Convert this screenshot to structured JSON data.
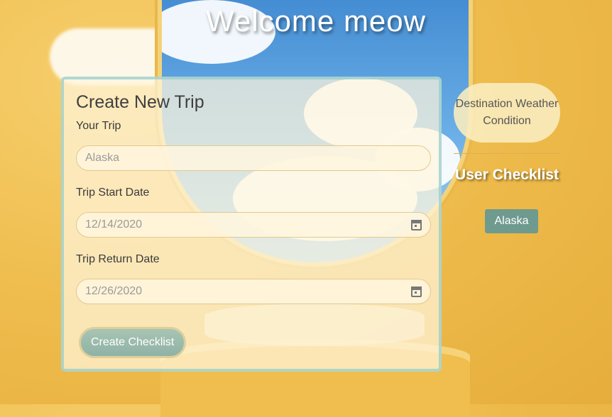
{
  "header": {
    "title": "Welcome meow"
  },
  "form": {
    "heading": "Create New Trip",
    "trip_label": "Your Trip",
    "trip_value": "Alaska",
    "start_label": "Trip Start Date",
    "start_value": "12/14/2020",
    "return_label": "Trip Return Date",
    "return_value": "12/26/2020",
    "submit_label": "Create Checklist"
  },
  "sidebar": {
    "weather_button": "Destination Weather Condition",
    "checklist_title": "User Checklist",
    "checklist_items": [
      "Alaska"
    ]
  },
  "icons": {
    "date_picker": "calendar-icon"
  },
  "colors": {
    "background": "#efbe4f",
    "card_border": "#96cdcd",
    "button": "#8fb2a5",
    "tag": "#6f9a8e"
  }
}
